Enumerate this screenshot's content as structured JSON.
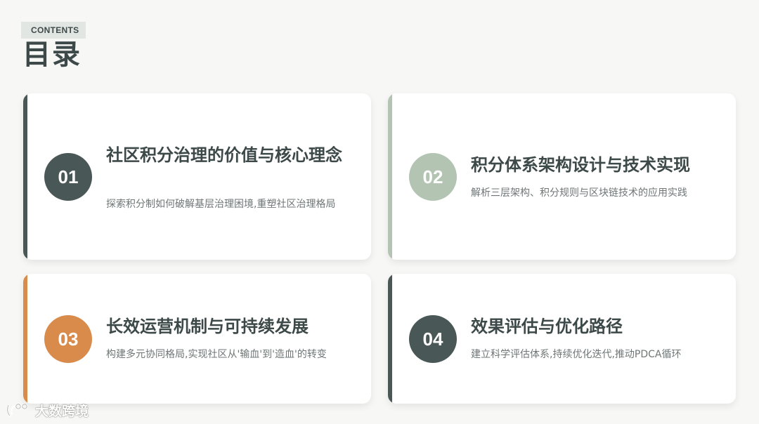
{
  "header": {
    "tag": "CONTENTS",
    "title": "目录"
  },
  "colors": {
    "dark": "#4a5757",
    "sage": "#b3c4b3",
    "orange": "#d98b4c",
    "text_dark": "#3d4949",
    "text_muted": "#6f7676"
  },
  "cards": [
    {
      "number": "01",
      "title": "社区积分治理的价值与核心理念",
      "desc": "探索积分制如何破解基层治理困境,重塑社区治理格局",
      "color": "#4a5757"
    },
    {
      "number": "02",
      "title": "积分体系架构设计与技术实现",
      "desc": "解析三层架构、积分规则与区块链技术的应用实践",
      "color": "#b3c4b3"
    },
    {
      "number": "03",
      "title": "长效运营机制与可持续发展",
      "desc": "构建多元协同格局,实现社区从'输血'到'造血'的转变",
      "color": "#d98b4c"
    },
    {
      "number": "04",
      "title": "效果评估与优化路径",
      "desc": "建立科学评估体系,持续优化迭代,推动PDCA循环",
      "color": "#4a5757"
    }
  ],
  "watermark": {
    "text": "大数跨境",
    "icon": "brand-logo-icon"
  }
}
